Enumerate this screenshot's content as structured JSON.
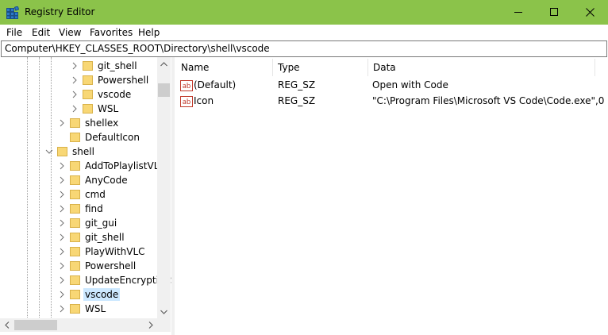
{
  "window": {
    "title": "Registry Editor",
    "titlebar_color": "#8bc34a"
  },
  "menu": [
    "File",
    "Edit",
    "View",
    "Favorites",
    "Help"
  ],
  "address": "Computer\\HKEY_CLASSES_ROOT\\Directory\\shell\\vscode",
  "tree": {
    "selected": "vscode",
    "items": [
      {
        "label": "git_shell",
        "expandable": true,
        "expanded": false,
        "selected": false
      },
      {
        "label": "Powershell",
        "expandable": true,
        "expanded": false,
        "selected": false
      },
      {
        "label": "vscode",
        "expandable": true,
        "expanded": false,
        "selected": false
      },
      {
        "label": "WSL",
        "expandable": true,
        "expanded": false,
        "selected": false
      },
      {
        "label": "shellex",
        "expandable": true,
        "expanded": false,
        "selected": false
      },
      {
        "label": "DefaultIcon",
        "expandable": false,
        "expanded": false,
        "selected": false
      },
      {
        "label": "shell",
        "expandable": true,
        "expanded": true,
        "selected": false
      },
      {
        "label": "AddToPlaylistVLC",
        "expandable": true,
        "expanded": false,
        "selected": false
      },
      {
        "label": "AnyCode",
        "expandable": true,
        "expanded": false,
        "selected": false
      },
      {
        "label": "cmd",
        "expandable": true,
        "expanded": false,
        "selected": false
      },
      {
        "label": "find",
        "expandable": true,
        "expanded": false,
        "selected": false
      },
      {
        "label": "git_gui",
        "expandable": true,
        "expanded": false,
        "selected": false
      },
      {
        "label": "git_shell",
        "expandable": true,
        "expanded": false,
        "selected": false
      },
      {
        "label": "PlayWithVLC",
        "expandable": true,
        "expanded": false,
        "selected": false
      },
      {
        "label": "Powershell",
        "expandable": true,
        "expanded": false,
        "selected": false
      },
      {
        "label": "UpdateEncryptionSettings",
        "expandable": true,
        "expanded": false,
        "selected": false
      },
      {
        "label": "vscode",
        "expandable": true,
        "expanded": false,
        "selected": true
      },
      {
        "label": "WSL",
        "expandable": true,
        "expanded": false,
        "selected": false
      }
    ]
  },
  "list": {
    "columns": [
      "Name",
      "Type",
      "Data"
    ],
    "rows": [
      {
        "icon": "string-value-icon",
        "name": "(Default)",
        "type": "REG_SZ",
        "data": "Open with Code"
      },
      {
        "icon": "string-value-icon",
        "name": "Icon",
        "type": "REG_SZ",
        "data": "\"C:\\Program Files\\Microsoft VS Code\\Code.exe\",0"
      }
    ]
  },
  "colors": {
    "selection": "#cce8ff",
    "folder": "#f8d775",
    "icon_red": "#c0392b"
  }
}
